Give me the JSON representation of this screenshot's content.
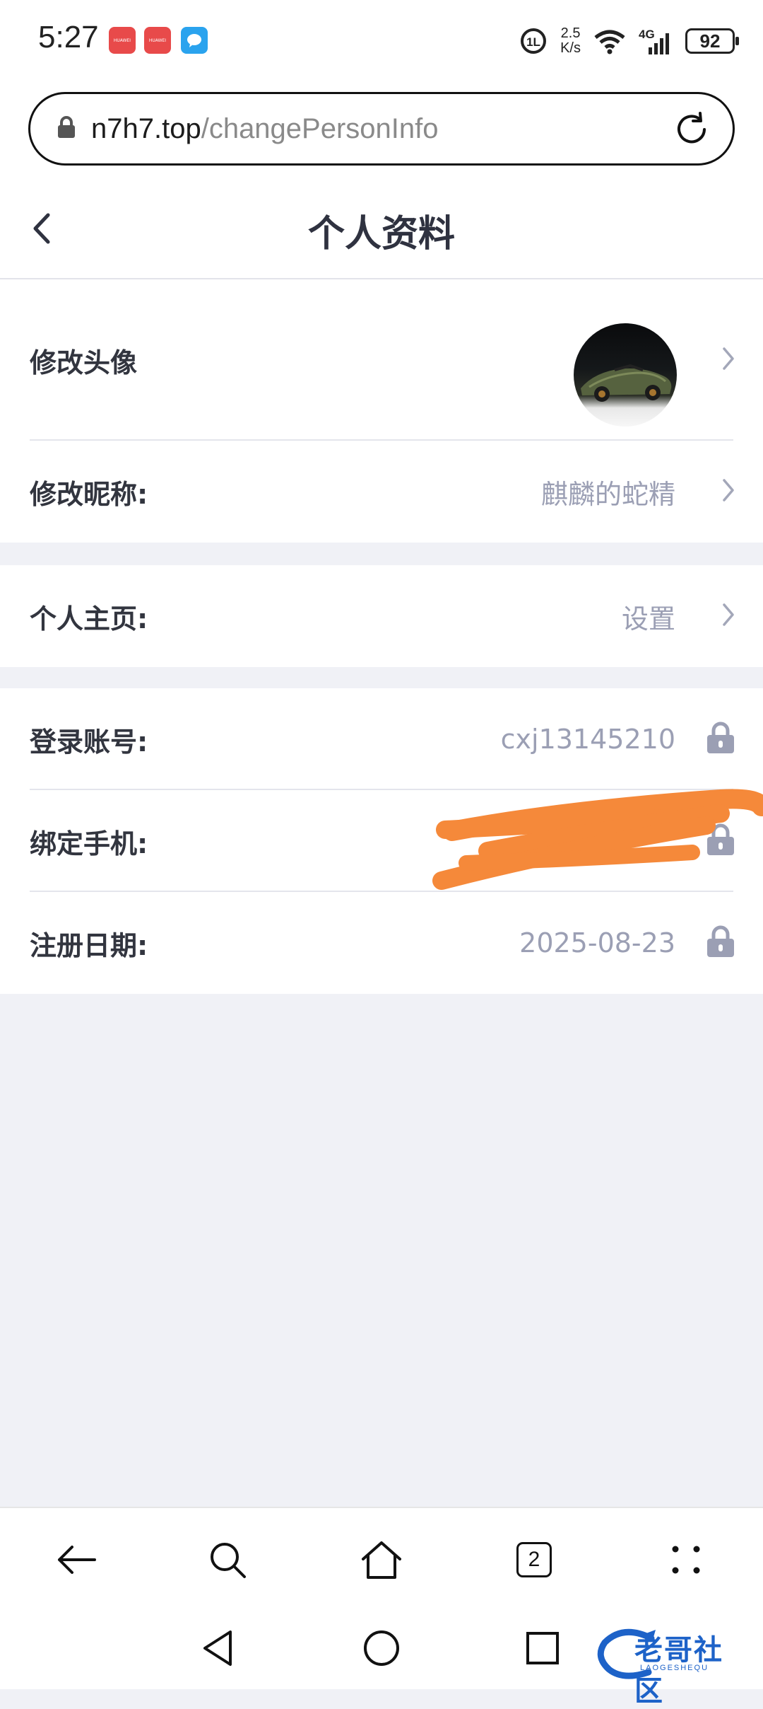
{
  "status_bar": {
    "time": "5:27",
    "network_speed_value": "2.5",
    "network_speed_unit": "K/s",
    "cellular": "4G",
    "battery": "92",
    "app_badge_label": "HUAWEI"
  },
  "browser": {
    "url_host": "n7h7.top",
    "url_path": "/changePersonInfo",
    "tab_count": "2"
  },
  "header": {
    "title": "个人资料"
  },
  "profile": {
    "rows": [
      {
        "label": "修改头像",
        "value": ""
      },
      {
        "label": "修改昵称:",
        "value": "麒麟的蛇精"
      },
      {
        "label": "个人主页:",
        "value": "设置"
      },
      {
        "label": "登录账号:",
        "value": "cxj13145210"
      },
      {
        "label": "绑定手机:",
        "value": ""
      },
      {
        "label": "注册日期:",
        "value": "2025-08-23"
      }
    ]
  },
  "watermark": {
    "text": "老哥社区",
    "sub": "LAOGESHEQU"
  },
  "colors": {
    "label": "#32353f",
    "value": "#9b9fb4",
    "background": "#f0f1f6",
    "scribble": "#f5893a",
    "watermark": "#1d62c8"
  },
  "icons": [
    "lock-icon",
    "reload-icon",
    "back-icon",
    "chevron-right-icon",
    "lock-icon",
    "search-icon",
    "home-icon",
    "tabs-icon",
    "more-icon"
  ]
}
